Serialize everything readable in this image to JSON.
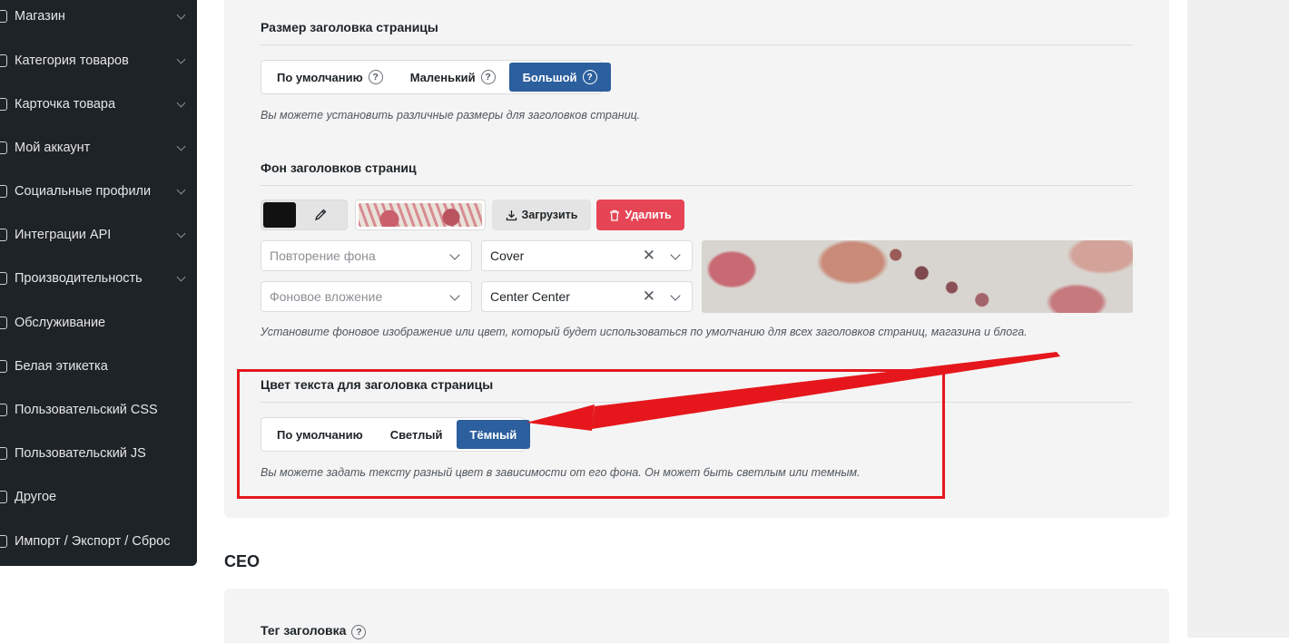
{
  "sidebar": {
    "items": [
      {
        "label": "Магазин"
      },
      {
        "label": "Категория товаров"
      },
      {
        "label": "Карточка товара"
      },
      {
        "label": "Мой аккаунт"
      },
      {
        "label": "Социальные профили"
      },
      {
        "label": "Интеграции API"
      },
      {
        "label": "Производительность"
      },
      {
        "label": "Обслуживание"
      },
      {
        "label": "Белая этикетка"
      },
      {
        "label": "Пользовательский CSS"
      },
      {
        "label": "Пользовательский JS"
      },
      {
        "label": "Другое"
      },
      {
        "label": "Импорт / Экспорт / Сброс"
      }
    ]
  },
  "title_size": {
    "heading": "Размер заголовка страницы",
    "options": [
      "По умолчанию",
      "Маленький",
      "Большой"
    ],
    "selected": "Большой",
    "description": "Вы можете установить различные размеры для заголовков страниц."
  },
  "title_bg": {
    "heading": "Фон заголовков страниц",
    "color": "#111111",
    "upload_label": "Загрузить",
    "delete_label": "Удалить",
    "repeat_placeholder": "Повторение фона",
    "size_value": "Cover",
    "attachment_placeholder": "Фоновое вложение",
    "position_value": "Center Center",
    "description": "Установите фоновое изображение или цвет, который будет использоваться по умолчанию для всех заголовков страниц, магазина и блога."
  },
  "title_color": {
    "heading": "Цвет текста для заголовка страницы",
    "options": [
      "По умолчанию",
      "Светлый",
      "Тёмный"
    ],
    "selected": "Тёмный",
    "description": "Вы можете задать тексту разный цвет в зависимости от его фона. Он может быть светлым или темным."
  },
  "seo": {
    "section_title": "СЕО",
    "tag_title": "Тег заголовка"
  },
  "colors": {
    "accent": "#2c5f9e",
    "danger": "#e54555",
    "highlight": "#e5171c"
  }
}
